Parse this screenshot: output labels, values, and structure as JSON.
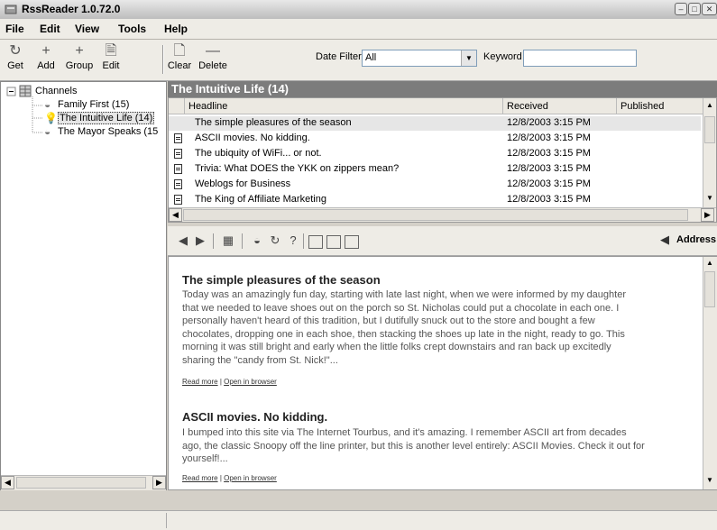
{
  "window": {
    "title": "RssReader 1.0.72.0"
  },
  "menu": [
    "File",
    "Edit",
    "View",
    "Tools",
    "Help"
  ],
  "toolbar": {
    "get": "Get",
    "add": "Add",
    "group": "Group",
    "edit": "Edit",
    "clear": "Clear",
    "delete": "Delete",
    "date_filter_label": "Date Filter",
    "date_filter_value": "All",
    "keyword_label": "Keyword",
    "keyword_value": ""
  },
  "tree": {
    "root": "Channels",
    "items": [
      {
        "label": "Family First (15)"
      },
      {
        "label": "The Intuitive Life (14)"
      },
      {
        "label": "The Mayor Speaks (15"
      }
    ]
  },
  "channel": {
    "header": "The Intuitive Life (14)"
  },
  "list": {
    "columns": [
      "Headline",
      "Received",
      "Published"
    ],
    "rows": [
      {
        "headline": "The simple pleasures of the season",
        "received": "12/8/2003 3:15 PM",
        "published": ""
      },
      {
        "headline": "ASCII movies. No kidding.",
        "received": "12/8/2003 3:15 PM",
        "published": ""
      },
      {
        "headline": "The ubiquity of WiFi... or not.",
        "received": "12/8/2003 3:15 PM",
        "published": ""
      },
      {
        "headline": "Trivia: What DOES the YKK on zippers mean?",
        "received": "12/8/2003 3:15 PM",
        "published": ""
      },
      {
        "headline": "Weblogs for Business",
        "received": "12/8/2003 3:15 PM",
        "published": ""
      },
      {
        "headline": "The King of Affiliate Marketing",
        "received": "12/8/2003 3:15 PM",
        "published": ""
      }
    ]
  },
  "browser": {
    "address_label": "Address:"
  },
  "articles": [
    {
      "title": "The simple pleasures of the season",
      "lines": [
        "Today was an amazingly fun day, starting with late last night, when we were informed by my daughter",
        "that we needed to leave shoes out on the porch so St. Nicholas could put a chocolate in each one. I",
        "personally haven't heard of this tradition, but I dutifully snuck out to the store and bought a few",
        "chocolates, dropping one in each shoe, then stacking the shoes up late in the night, ready to go. This",
        "morning it was still bright and early when the little folks crept downstairs and ran back up excitedly",
        "sharing the \"candy from St. Nick!\"..."
      ],
      "read_more": "Read more",
      "open_browser": "Open in browser",
      "sep": "|"
    },
    {
      "title": "ASCII movies. No kidding.",
      "lines": [
        "I bumped into this site via The Internet Tourbus, and it's amazing. I remember ASCII art from decades",
        "ago, the classic Snoopy off the line printer, but this is another level entirely: ASCII Movies. Check it out for",
        "yourself!..."
      ],
      "read_more": "Read more",
      "open_browser": "Open in browser",
      "sep": "|"
    }
  ],
  "colors": {
    "header_bg": "#7c7c7c",
    "selected_bg": "#e6e6e6",
    "chrome": "#eeece6"
  }
}
